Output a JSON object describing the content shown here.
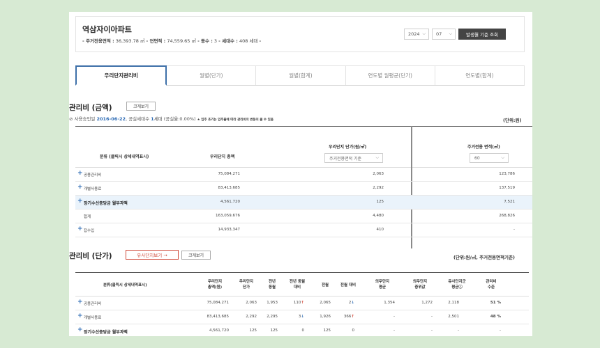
{
  "apartment": {
    "name": "역삼자이아파트",
    "info_parts": [
      {
        "key": "- 주거전용면적 :",
        "val": " 36,393.78 ㎡"
      },
      {
        "key": "  - 연면적 :",
        "val": " 74,559.65 ㎡"
      },
      {
        "key": "  - 동수 :",
        "val": " 3"
      },
      {
        "key": "  - 세대수 :",
        "val": " 408 세대"
      },
      {
        "key": "  -",
        "val": ""
      }
    ],
    "year": "2024",
    "month": "07",
    "search_button": "발생월 기준 조회"
  },
  "tabs": [
    "우리단지관리비",
    "월별(단가)",
    "월별(합계)",
    "연도별 월평균(단가)",
    "연도별(합계)"
  ],
  "section1": {
    "title": "관리비 (금액)",
    "zoom_button": "크게보기",
    "note_prefix": "⊘ 사용승인일 ",
    "approval_date": "2016-06-22",
    "note_mid": ", 공실세대수 ",
    "vacant_count": "1",
    "note_tail": "세대 (공실율:0.00%)",
    "note_small": "★ 입주 초기는 입주율에 따라 관리비의 변동이 클 수 있음",
    "unit": "(단위:원)",
    "headers": {
      "category": "분류 (클릭시 상세내역표시)",
      "total": "우리단지 총액",
      "unit_price": "우리단지 단가(원/㎡)",
      "area": "주거전용 면적(㎡)"
    },
    "unit_select": "주거전용면적 기준",
    "area_select": "60",
    "rows": [
      {
        "label": "공용관리비",
        "plus": true,
        "bold": false,
        "total": "75,084,271",
        "unit_price": "2,063",
        "area": "123,786",
        "hl": false
      },
      {
        "label": "개별사용료",
        "plus": true,
        "bold": false,
        "total": "83,413,685",
        "unit_price": "2,292",
        "area": "137,519",
        "hl": false
      },
      {
        "label": "장기수선충당금 월부과액",
        "plus": true,
        "bold": true,
        "total": "4,561,720",
        "unit_price": "125",
        "area": "7,521",
        "hl": true
      },
      {
        "label": "합계",
        "plus": false,
        "bold": false,
        "total": "163,059,676",
        "unit_price": "4,480",
        "area": "268,826",
        "hl": false
      },
      {
        "label": "잡수입",
        "plus": true,
        "bold": false,
        "total": "14,933,347",
        "unit_price": "410",
        "area": "-",
        "hl": false
      }
    ]
  },
  "section2": {
    "title": "관리비 (단가)",
    "similar_button": "유사단지보기 →",
    "zoom_button": "크게보기",
    "unit": "(단위:원/㎡, 주거전용면적기준)",
    "headers": [
      "분류(클릭시 상세내역표시)",
      "우리단지\n총액(원)",
      "우리단지\n단가",
      "전년\n동월",
      "전년 동월\n대비",
      "전월",
      "전월 대비",
      "의무단지\n평균",
      "의무단지\n중위값",
      "유사단지군\n평균ⓘ",
      "관리비\n수준"
    ],
    "rows": [
      {
        "label": "공용관리비",
        "bold": false,
        "total": "75,084,271",
        "unit": "2,063",
        "prev_year": "1,953",
        "yoy": "110",
        "yoy_dir": "up",
        "prev_month": "2,065",
        "mom": "2",
        "mom_dir": "down",
        "mand_avg": "1,354",
        "mand_med": "1,272",
        "similar": "2,118",
        "level": "51 %"
      },
      {
        "label": "개별사용료",
        "bold": false,
        "total": "83,413,685",
        "unit": "2,292",
        "prev_year": "2,295",
        "yoy": "3",
        "yoy_dir": "down",
        "prev_month": "1,926",
        "mom": "366",
        "mom_dir": "up",
        "mand_avg": "-",
        "mand_med": "-",
        "similar": "2,501",
        "level": "48 %"
      },
      {
        "label": "장기수선충당금 월부과액",
        "bold": true,
        "total": "4,561,720",
        "unit": "125",
        "prev_year": "125",
        "yoy": "0",
        "yoy_dir": "",
        "prev_month": "125",
        "mom": "0",
        "mom_dir": "",
        "mand_avg": "-",
        "mand_med": "-",
        "similar": "-",
        "level": "-"
      }
    ]
  },
  "colors": {
    "background": "#d7ead3",
    "accent_blue": "#2d6bb5",
    "tab_border": "#3d6fa8",
    "up_red": "#d23a2a",
    "dark_button": "#444444"
  }
}
